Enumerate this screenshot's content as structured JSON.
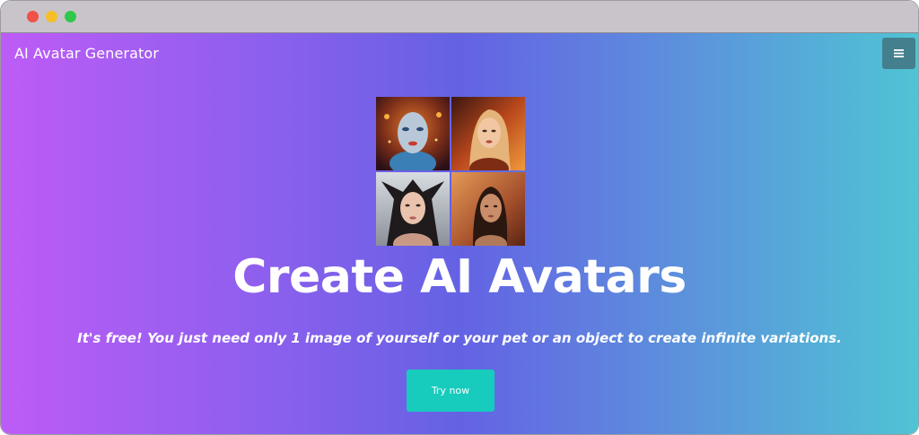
{
  "app": {
    "brand": "AI Avatar Generator",
    "menu_icon": "hamburger-icon"
  },
  "hero": {
    "title": "Create AI Avatars",
    "subtitle": "It's free! You just need only 1 image of yourself or your pet or an object to create infinite variations.",
    "cta_label": "Try now"
  },
  "colors": {
    "gradient_start": "#bd5cf6",
    "gradient_mid": "#6462e4",
    "gradient_end": "#4fc4d4",
    "cta": "#17cbbd",
    "menu_button": "#447f8d"
  }
}
